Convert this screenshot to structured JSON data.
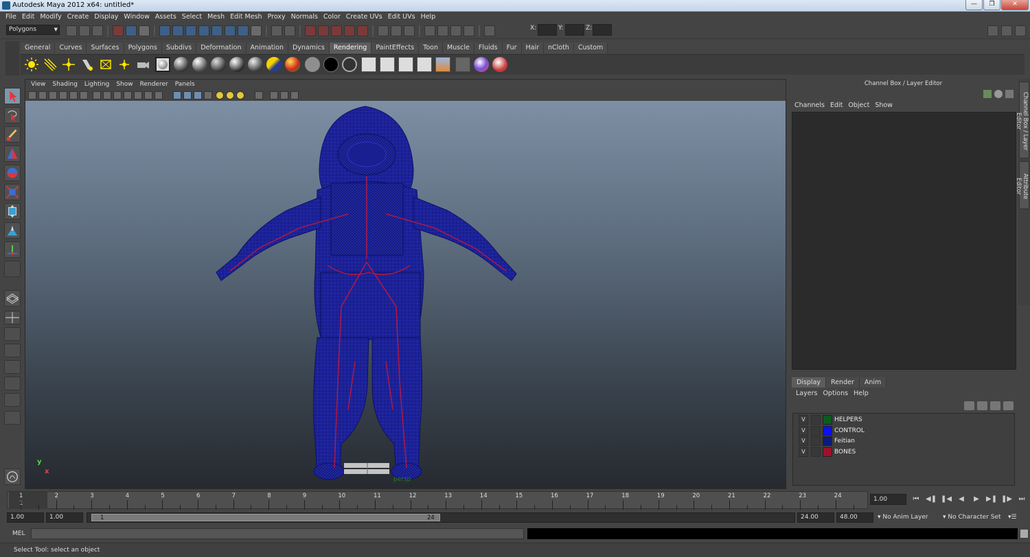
{
  "window": {
    "title": "Autodesk Maya 2012 x64: untitled*"
  },
  "menubar": [
    "File",
    "Edit",
    "Modify",
    "Create",
    "Display",
    "Window",
    "Assets",
    "Select",
    "Mesh",
    "Edit Mesh",
    "Proxy",
    "Normals",
    "Color",
    "Create UVs",
    "Edit UVs",
    "Help"
  ],
  "status_line": {
    "mode": "Polygons",
    "x_label": "X:",
    "y_label": "Y:",
    "z_label": "Z:"
  },
  "shelf": {
    "tabs": [
      "General",
      "Curves",
      "Surfaces",
      "Polygons",
      "Subdivs",
      "Deformation",
      "Animation",
      "Dynamics",
      "Rendering",
      "PaintEffects",
      "Toon",
      "Muscle",
      "Fluids",
      "Fur",
      "Hair",
      "nCloth",
      "Custom"
    ],
    "active_tab": "Rendering"
  },
  "panel": {
    "menu": [
      "View",
      "Shading",
      "Lighting",
      "Show",
      "Renderer",
      "Panels"
    ],
    "camera": "persp",
    "axis_y": "y",
    "axis_x": "x"
  },
  "channel_box": {
    "title": "Channel Box / Layer Editor",
    "menu": [
      "Channels",
      "Edit",
      "Object",
      "Show"
    ]
  },
  "side_tabs": [
    "Channel Box / Layer Editor",
    "Attribute Editor"
  ],
  "layer_editor": {
    "tabs": [
      "Display",
      "Render",
      "Anim"
    ],
    "active_tab": "Display",
    "menu": [
      "Layers",
      "Options",
      "Help"
    ],
    "layers": [
      {
        "visible": "V",
        "name": "HELPERS",
        "color": "#0b5b1e"
      },
      {
        "visible": "V",
        "name": "CONTROL",
        "color": "#1010f0"
      },
      {
        "visible": "V",
        "name": "Feitian",
        "color": "#0c1a7a"
      },
      {
        "visible": "V",
        "name": "BONES",
        "color": "#a0102a"
      }
    ]
  },
  "time_slider": {
    "ticks": [
      "1",
      "2",
      "3",
      "4",
      "5",
      "6",
      "7",
      "8",
      "9",
      "10",
      "11",
      "12",
      "13",
      "14",
      "15",
      "16",
      "17",
      "18",
      "19",
      "20",
      "21",
      "22",
      "23",
      "24"
    ],
    "current_frame": "1",
    "current_time": "1.00"
  },
  "range": {
    "start": "1.00",
    "anim_start": "1.00",
    "bar_start": "1",
    "bar_end": "24",
    "end": "24.00",
    "anim_end": "48.00",
    "anim_layer": "No Anim Layer",
    "character_set": "No Character Set"
  },
  "command_line": {
    "label": "MEL"
  },
  "help_line": {
    "text": "Select Tool: select an object"
  }
}
